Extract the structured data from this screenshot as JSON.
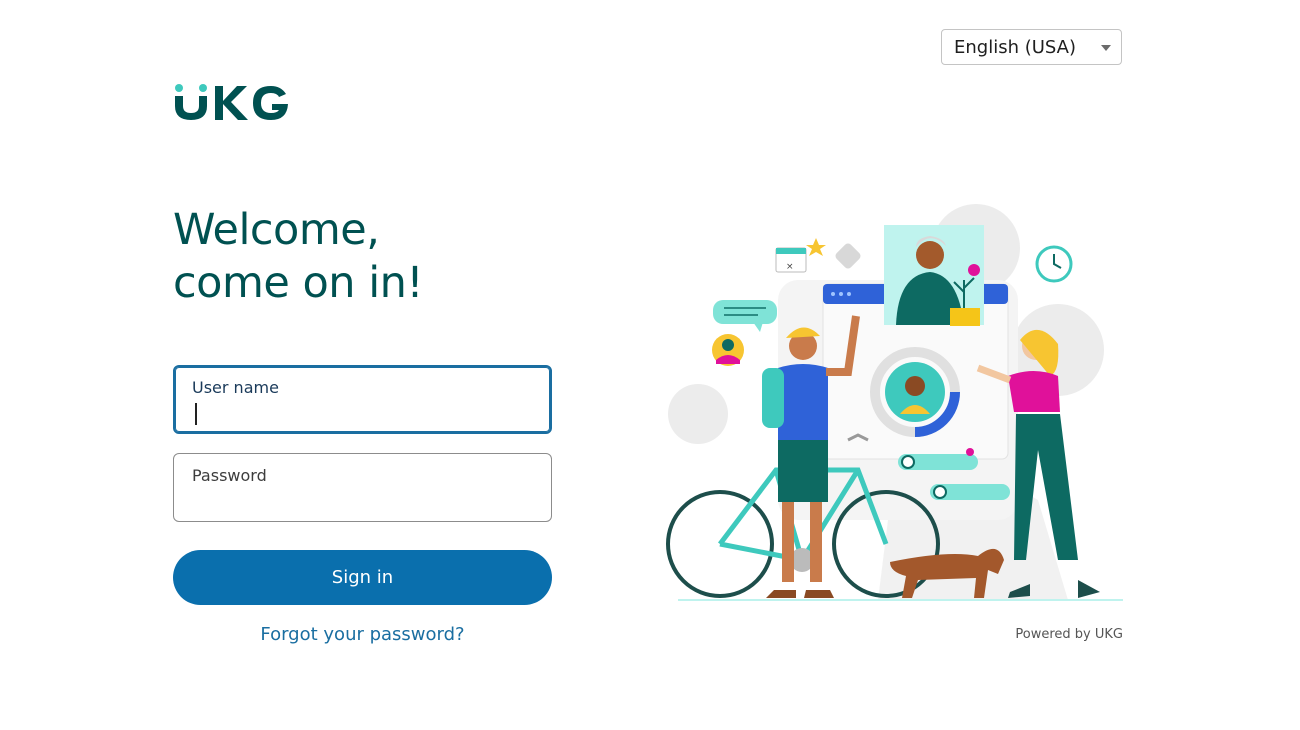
{
  "language": {
    "selected": "English (USA)"
  },
  "brand": {
    "logo_text": "UKG"
  },
  "welcome": {
    "line1": "Welcome,",
    "line2": "come on in!"
  },
  "form": {
    "username_label": "User name",
    "username_value": "",
    "password_label": "Password",
    "password_value": "",
    "signin_label": "Sign in",
    "forgot_label": "Forgot your password?"
  },
  "footer": {
    "powered_by": "Powered by UKG"
  },
  "colors": {
    "brand_teal": "#005151",
    "accent_teal": "#3ec9bd",
    "primary_blue": "#0a6fad",
    "link_blue": "#1a6ea1"
  }
}
